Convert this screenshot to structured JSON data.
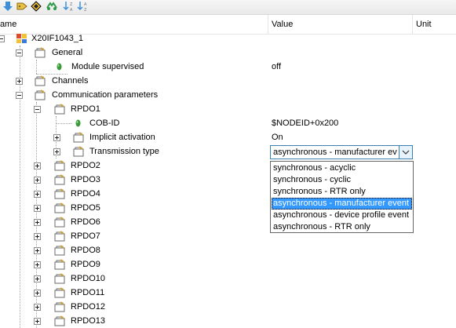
{
  "toolbar": {
    "buttons": [
      {
        "name": "toolbar-down-arrow-icon"
      },
      {
        "name": "toolbar-tag-icon"
      },
      {
        "name": "toolbar-diamond-icon"
      },
      {
        "name": "toolbar-link-icon"
      },
      {
        "name": "toolbar-sort-desc-icon"
      },
      {
        "name": "toolbar-sort-asc-icon"
      }
    ]
  },
  "header": {
    "name_col": "Name",
    "value_col": "Value",
    "unit_col": "Unit"
  },
  "tree": {
    "root": "X20IF1043_1",
    "general": "General",
    "module_supervised": {
      "label": "Module supervised",
      "value": "off"
    },
    "channels": "Channels",
    "comm_params": "Communication parameters",
    "rpdo1": "RPDO1",
    "cob_id": {
      "label": "COB-ID",
      "value": "$NODEID+0x200"
    },
    "implicit_activation": {
      "label": "Implicit activation",
      "value": "On"
    },
    "transmission_type": {
      "label": "Transmission type",
      "value": "asynchronous - manufacturer ev"
    },
    "rpdos": [
      "RPDO2",
      "RPDO3",
      "RPDO4",
      "RPDO5",
      "RPDO6",
      "RPDO7",
      "RPDO8",
      "RPDO9",
      "RPDO10",
      "RPDO11",
      "RPDO12",
      "RPDO13"
    ]
  },
  "dropdown": {
    "options": [
      "synchronous - acyclic",
      "synchronous - cyclic",
      "synchronous - RTR only",
      "asynchronous - manufacturer event",
      "asynchronous - device profile event",
      "asynchronous - RTR only"
    ],
    "selected_index": 3
  },
  "colors": {
    "selection": "#3399ff",
    "combo_border": "#3c7fb1",
    "leaf_icon": "#3a9a3a"
  }
}
